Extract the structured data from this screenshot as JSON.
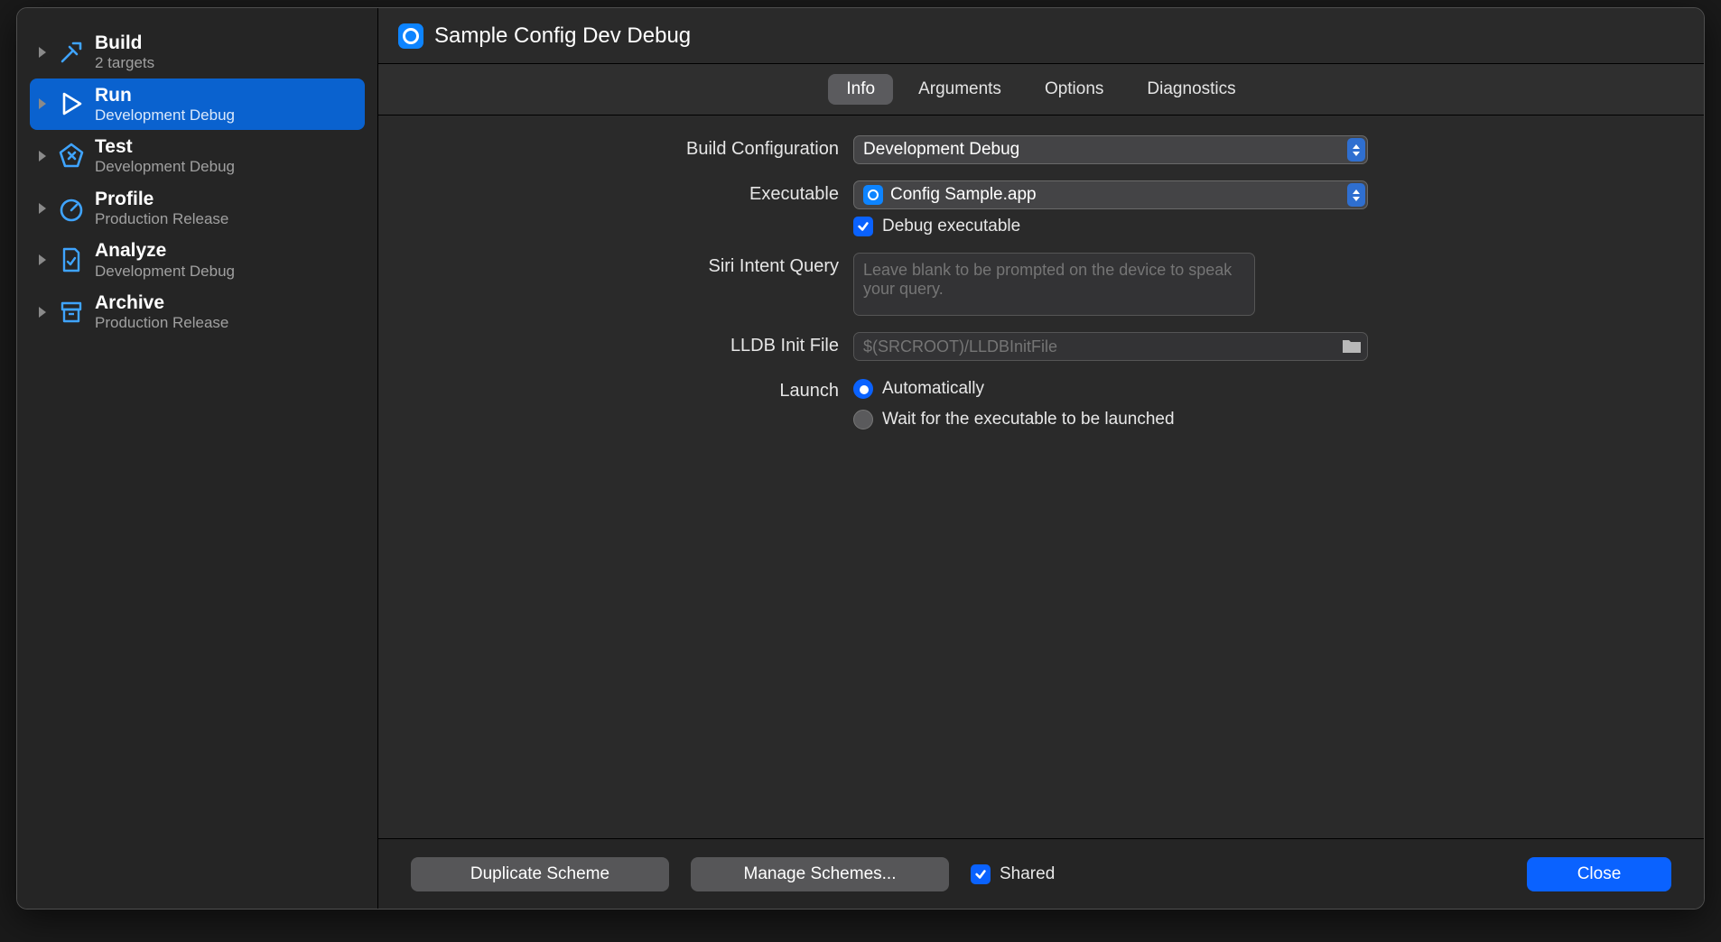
{
  "header": {
    "scheme_name": "Sample Config Dev Debug"
  },
  "sidebar": {
    "items": [
      {
        "title": "Build",
        "subtitle": "2 targets"
      },
      {
        "title": "Run",
        "subtitle": "Development Debug"
      },
      {
        "title": "Test",
        "subtitle": "Development Debug"
      },
      {
        "title": "Profile",
        "subtitle": "Production Release"
      },
      {
        "title": "Analyze",
        "subtitle": "Development Debug"
      },
      {
        "title": "Archive",
        "subtitle": "Production Release"
      }
    ]
  },
  "tabs": {
    "info": "Info",
    "arguments": "Arguments",
    "options": "Options",
    "diagnostics": "Diagnostics"
  },
  "form": {
    "build_configuration": {
      "label": "Build Configuration",
      "value": "Development Debug"
    },
    "executable": {
      "label": "Executable",
      "value": "Config Sample.app",
      "debug_label": "Debug executable"
    },
    "siri": {
      "label": "Siri Intent Query",
      "placeholder": "Leave blank to be prompted on the device to speak your query."
    },
    "lldb": {
      "label": "LLDB Init File",
      "placeholder": "$(SRCROOT)/LLDBInitFile"
    },
    "launch": {
      "label": "Launch",
      "auto": "Automatically",
      "wait": "Wait for the executable to be launched"
    }
  },
  "footer": {
    "duplicate": "Duplicate Scheme",
    "manage": "Manage Schemes...",
    "shared": "Shared",
    "close": "Close"
  }
}
